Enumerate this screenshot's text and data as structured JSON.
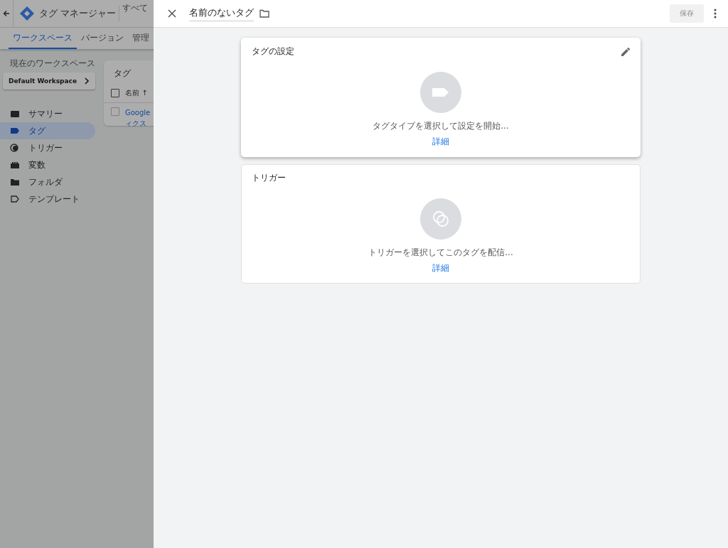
{
  "background_app": {
    "title": "タグ マネージャー",
    "account_label": "すべて",
    "tabs": [
      {
        "label": "ワークスペース",
        "selected": true
      },
      {
        "label": "バージョン",
        "selected": false
      },
      {
        "label": "管理",
        "selected": false
      }
    ],
    "workspace": {
      "caption": "現在のワークスペース",
      "name": "Default Workspace"
    },
    "nav": [
      {
        "label": "サマリー",
        "selected": false
      },
      {
        "label": "タグ",
        "selected": true
      },
      {
        "label": "トリガー",
        "selected": false
      },
      {
        "label": "変数",
        "selected": false
      },
      {
        "label": "フォルダ",
        "selected": false
      },
      {
        "label": "テンプレート",
        "selected": false
      }
    ],
    "table": {
      "title": "タグ",
      "select_all_checked": false,
      "column_name": "名前",
      "sort_arrow": "↑",
      "rows": [
        {
          "name_lines": [
            "Google",
            "ィクス"
          ],
          "checked": false
        }
      ]
    }
  },
  "panel": {
    "title": "名前のないタグ",
    "save_label": "保存",
    "save_disabled": true,
    "cards": [
      {
        "kind": "tag",
        "title": "タグの設定",
        "hint": "タグタイプを選択して設定を開始...",
        "link": "詳細",
        "elevated": true
      },
      {
        "kind": "trigger",
        "title": "トリガー",
        "hint": "トリガーを選択してこのタグを配信...",
        "link": "詳細",
        "elevated": false
      }
    ]
  }
}
